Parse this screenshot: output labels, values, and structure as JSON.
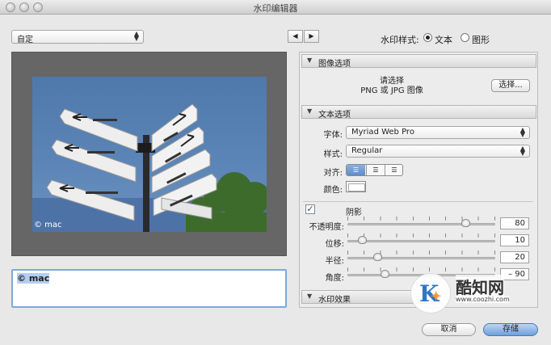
{
  "window": {
    "title": "水印编辑器"
  },
  "preset": {
    "value": "自定"
  },
  "nav": {
    "prev": "◀",
    "next": "▶"
  },
  "watermark_style": {
    "label": "水印样式:",
    "options": [
      {
        "label": "文本",
        "selected": true
      },
      {
        "label": "图形",
        "selected": false
      }
    ]
  },
  "preview": {
    "watermark_text": "© mac"
  },
  "text_input": {
    "value": "© mac"
  },
  "image_options": {
    "header": "图像选项",
    "prompt_line1": "请选择",
    "prompt_line2": "PNG 或 JPG 图像",
    "choose_button": "选择..."
  },
  "text_options": {
    "header": "文本选项",
    "font_label": "字体:",
    "font_value": "Myriad Web Pro",
    "style_label": "样式:",
    "style_value": "Regular",
    "align_label": "对齐:",
    "align_selected": "left",
    "color_label": "颜色:",
    "text_color": "#ffffff"
  },
  "shadow": {
    "label": "阴影",
    "enabled": true,
    "sliders": [
      {
        "label": "不透明度:",
        "value": "80",
        "fraction": 0.8
      },
      {
        "label": "位移:",
        "value": "10",
        "fraction": 0.1
      },
      {
        "label": "半径:",
        "value": "20",
        "fraction": 0.2
      },
      {
        "label": "角度:",
        "value": "– 90",
        "fraction": 0.25
      }
    ]
  },
  "watermark_effects": {
    "header": "水印效果"
  },
  "buttons": {
    "cancel": "取消",
    "save": "存储"
  },
  "site_watermark": {
    "brand": "酷知网",
    "url": "www.coozhi.com"
  },
  "colors": {
    "accent": "#5f8cc7",
    "sky": "#5d86b8"
  }
}
